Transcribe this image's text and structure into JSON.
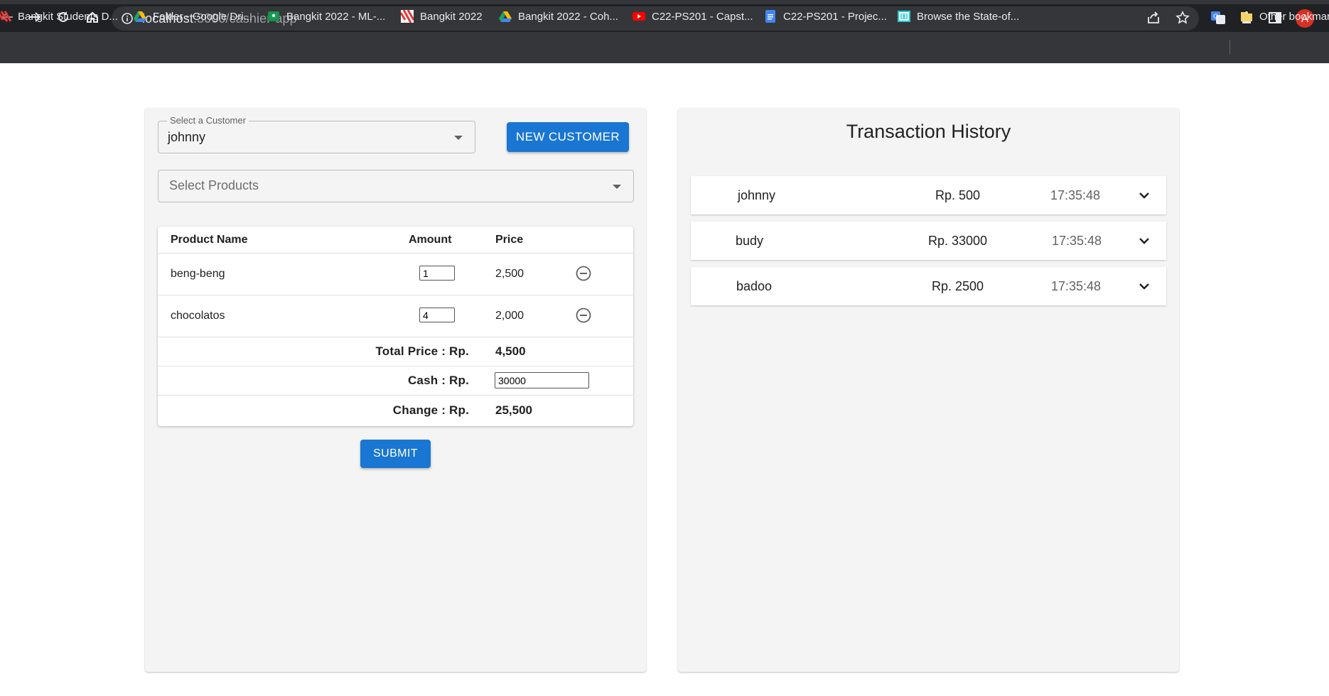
{
  "browser": {
    "url_host": "localhost",
    "url_path": ":3000/cashier-app",
    "avatar_letter": "A",
    "bookmarks": [
      {
        "label": "Bangkit Students D...",
        "icon": "bangkit-icon"
      },
      {
        "label": "Folder - Google Dri...",
        "icon": "google-drive-icon"
      },
      {
        "label": "Bangkit 2022 - ML-...",
        "icon": "classroom-icon"
      },
      {
        "label": "Bangkit 2022",
        "icon": "bangkit-icon"
      },
      {
        "label": "Bangkit 2022 - Coh...",
        "icon": "google-drive-icon"
      },
      {
        "label": "C22-PS201 - Capst...",
        "icon": "youtube-icon"
      },
      {
        "label": "C22-PS201 - Projec...",
        "icon": "google-docs-icon"
      },
      {
        "label": "Browse the State-of...",
        "icon": "papers-with-code-icon"
      }
    ],
    "other_bookmarks": "Other bookmarks"
  },
  "cashier": {
    "customer_label": "Select a Customer",
    "customer_value": "johnny",
    "new_customer_button": "NEW CUSTOMER",
    "products_placeholder": "Select Products",
    "table": {
      "headers": {
        "name": "Product Name",
        "amount": "Amount",
        "price": "Price"
      },
      "rows": [
        {
          "name": "beng-beng",
          "amount": "1",
          "price": "2,500"
        },
        {
          "name": "chocolatos",
          "amount": "4",
          "price": "2,000"
        }
      ],
      "total_label": "Total Price : Rp.",
      "total_value": "4,500",
      "cash_label": "Cash : Rp.",
      "cash_value": "30000",
      "change_label": "Change : Rp.",
      "change_value": "25,500"
    },
    "submit_button": "SUBMIT"
  },
  "history": {
    "title": "Transaction History",
    "transactions": [
      {
        "name": "johnny",
        "amount": "Rp. 500",
        "time": "17:35:48"
      },
      {
        "name": "budy",
        "amount": "Rp. 33000",
        "time": "17:35:48"
      },
      {
        "name": "badoo",
        "amount": "Rp. 2500",
        "time": "17:35:48"
      }
    ]
  },
  "colors": {
    "primary": "#1976d2",
    "card_bg": "#f4f4f4",
    "chrome_dark": "#202124"
  }
}
